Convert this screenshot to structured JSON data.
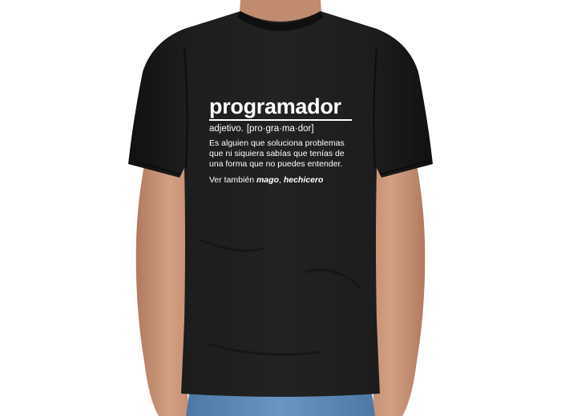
{
  "tshirt": {
    "color": "#1a1a1a",
    "print_color": "#ffffff",
    "word": "programador",
    "part_of_speech": "adjetivo.",
    "syllables": "[pro·gra·ma·dor]",
    "definition_lines": [
      "Es alguien que soluciona problemas",
      "que ni siquiera sabías que tenías de",
      "una forma que no puedes entender."
    ],
    "see_also_prefix": "Ver también",
    "see_also_word_1": "mago",
    "see_also_sep": ",",
    "see_also_word_2": "hechicero"
  },
  "model": {
    "skin_color": "#c99478",
    "jeans_color": "#5b86b3"
  }
}
